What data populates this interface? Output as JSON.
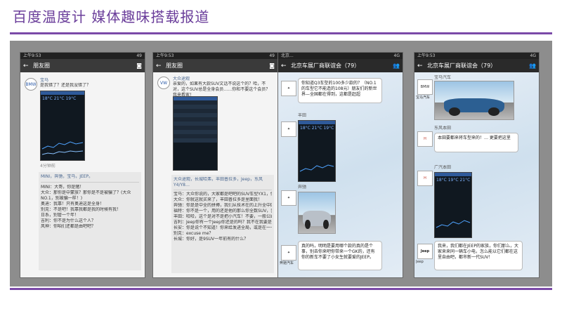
{
  "slide": {
    "title": "百度温度计  媒体趣味搭载报道"
  },
  "phone1": {
    "status_left": "上午9:53",
    "status_right": "49",
    "nav_title": "朋友圈",
    "poster_name": "宝马",
    "post_text_1": "是我错了？还是我没错了？",
    "shot_nums": "18°C  21°C  19°C",
    "time": "4分钟前",
    "likes": "MINI，奔驰，宝马，JEEP。",
    "comments": [
      "MINI：大哥，你是猪！",
      "大众：那你是中蒙族？那你是不是被骗了？(大众NO.1，别被骗一样！)",
      "奥迪：我靠！只有奥迪这是全身！",
      "别克：不是吧！我靠我都是我的时候有我！",
      "日系，别管一个年！",
      "吉利：你不是为什么这个人？",
      "风神：你咱们还都是由吧吧？"
    ]
  },
  "phone2": {
    "status_left": "上午9:53",
    "status_right": "49",
    "nav_title": "朋友圈",
    "poster_name": "大众途观",
    "post_text": "亲爱的，如果有大款SUV文话不说这个的？哈，不对，这个SUV总是全身会员……你和不要这个会员？我来看家！",
    "likes": "大众途观，长城哈弗，丰田普拉多，Jeep，东风Y4/Y8…",
    "comments": [
      "宝马：大众你说的，大家都是吧吧的SUV车型YX1，你还我要上！",
      "大众：你就这就买来了，丰田普拉多是里面我！",
      "奔驰：你是是中全的拼搏，我们从技术在的上升全中国来者这样是奔驰！",
      "福特：你不是一个，用的还是他的那么你全数SUV，我们别……",
      "丰田：哈哈，这个是对不是把小汽车！不要，一般公路 你上 要你要的车SUV，用得很少呢！",
      "吉利：Jeep你有一个Jeep你还是的吗？我不在我要是说个是boy！",
      "长安：你是说个不知道！你来给发进全局，或是在一一选！",
      "别克：excuse me？",
      "长城：你好，是9SUV一年前有的什么？"
    ]
  },
  "phone3": {
    "status_left": "北京...",
    "status_right": "4G",
    "nav_title": "北京车展厂商联谊会（79）",
    "msg1": "你知道Q3车型的100多少款的？（NO.1的车型它不能造的108元）朋友们的新世界—全国都在得到，这都是赶超",
    "sender2": "丰田",
    "shot_nums": "18°C  21°C  19°C",
    "sender3": "奔驰",
    "msg4": "真的吗，明明是要用哪个款的真的是个事，别去你来吧你带来一个GK的，还有你的新车不要了小女生就要爱的JEEP。",
    "logo_caption": "奔驰汽车"
  },
  "phone4": {
    "status_left": "上午9:53",
    "status_right": "4G",
    "nav_title": "北京车展厂商联谊会（79）",
    "sender1": "宝马汽车",
    "logo_caption1": "宝马汽车",
    "sender2": "东风本田",
    "msg2": "本田要都来将车型来的！… 更要把这里",
    "sender3": "广汽本田",
    "shot_nums": "18°C  19°C  21°C",
    "msg4": "我来，我们都在JEEP的家族，你们那么，大家来来同一辆车小电，怎么能以它们都在这里自由吧，都市新一代SUV！",
    "logo_caption3": "Jeep"
  }
}
